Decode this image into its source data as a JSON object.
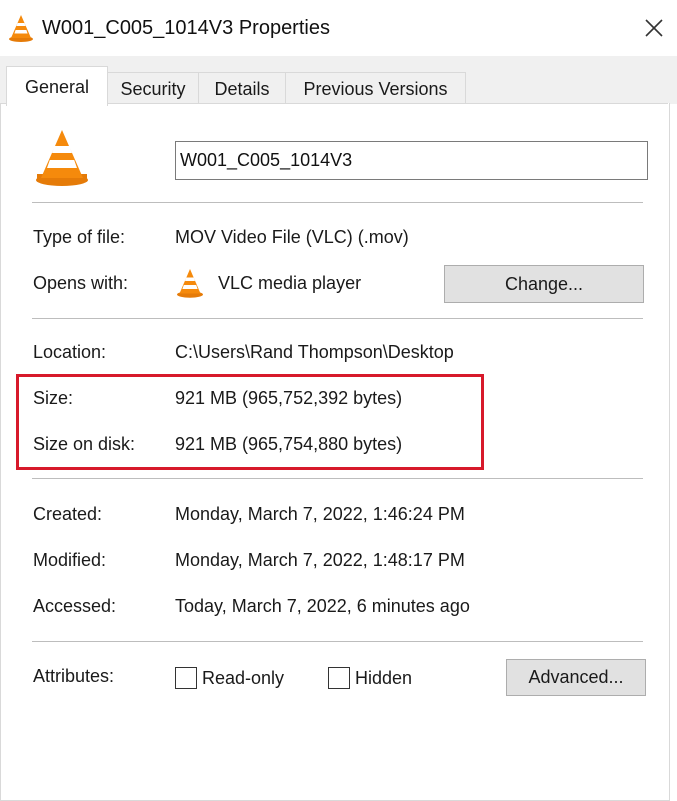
{
  "window": {
    "title": "W001_C005_1014V3 Properties",
    "close_glyph": "✕",
    "icon": "vlc-cone-icon"
  },
  "tabs": [
    {
      "label": "General",
      "active": true
    },
    {
      "label": "Security",
      "active": false
    },
    {
      "label": "Details",
      "active": false
    },
    {
      "label": "Previous Versions",
      "active": false
    }
  ],
  "general": {
    "file_name": "W001_C005_1014V3",
    "file_icon": "vlc-cone-icon",
    "type_label": "Type of file:",
    "type_value": "MOV Video File (VLC) (.mov)",
    "opens_label": "Opens with:",
    "opens_value": "VLC media player",
    "opens_icon": "vlc-cone-icon",
    "change_button": "Change...",
    "location_label": "Location:",
    "location_value": "C:\\Users\\Rand Thompson\\Desktop",
    "size_label": "Size:",
    "size_value": "921 MB (965,752,392 bytes)",
    "size_on_disk_label": "Size on disk:",
    "size_on_disk_value": "921 MB (965,754,880 bytes)",
    "created_label": "Created:",
    "created_value": "Monday, March 7, 2022, 1:46:24 PM",
    "modified_label": "Modified:",
    "modified_value": "Monday, March 7, 2022, 1:48:17 PM",
    "accessed_label": "Accessed:",
    "accessed_value": "Today, March 7, 2022, 6 minutes ago",
    "attributes_label": "Attributes:",
    "readonly_label": "Read-only",
    "readonly_checked": false,
    "hidden_label": "Hidden",
    "hidden_checked": false,
    "advanced_button": "Advanced..."
  },
  "colors": {
    "highlight": "#d7192a",
    "vlc_orange": "#f08a0f"
  }
}
